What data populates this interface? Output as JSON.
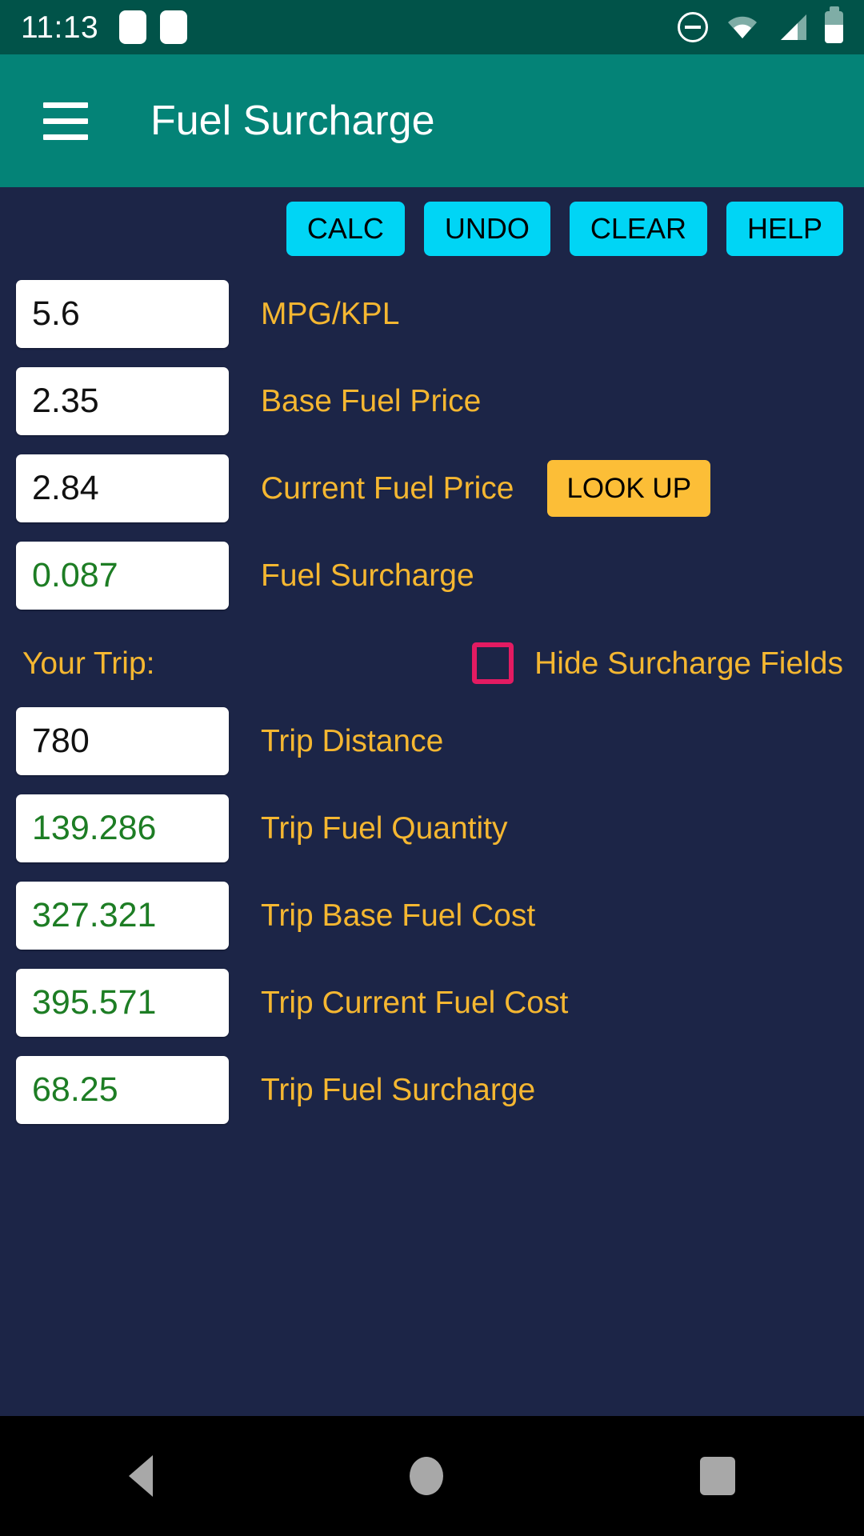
{
  "status_bar": {
    "clock": "11:13",
    "icons": [
      "notification-block-icon",
      "notification-block-icon",
      "do-not-disturb-icon",
      "wifi-icon",
      "cellular-signal-icon",
      "battery-icon"
    ]
  },
  "app_bar": {
    "menu_icon": "hamburger-menu-icon",
    "title": "Fuel Surcharge"
  },
  "toolbar": {
    "calc_label": "CALC",
    "undo_label": "UNDO",
    "clear_label": "CLEAR",
    "help_label": "HELP"
  },
  "surcharge_fields": [
    {
      "value": "5.6",
      "label": "MPG/KPL",
      "computed": false,
      "name": "mpg-kpl"
    },
    {
      "value": "2.35",
      "label": "Base Fuel Price",
      "computed": false,
      "name": "base-fuel-price"
    },
    {
      "value": "2.84",
      "label": "Current Fuel Price",
      "computed": false,
      "name": "current-fuel-price"
    },
    {
      "value": "0.087",
      "label": "Fuel Surcharge",
      "computed": true,
      "name": "fuel-surcharge"
    }
  ],
  "lookup": {
    "label": "LOOK UP"
  },
  "trip_section": {
    "title": "Your Trip:",
    "checkbox_label": "Hide Surcharge Fields",
    "checkbox_checked": false
  },
  "trip_fields": [
    {
      "value": "780",
      "label": "Trip Distance",
      "computed": false,
      "name": "trip-distance"
    },
    {
      "value": "139.286",
      "label": "Trip Fuel Quantity",
      "computed": true,
      "name": "trip-fuel-quantity"
    },
    {
      "value": "327.321",
      "label": "Trip Base Fuel Cost",
      "computed": true,
      "name": "trip-base-fuel-cost"
    },
    {
      "value": "395.571",
      "label": "Trip Current Fuel Cost",
      "computed": true,
      "name": "trip-current-fuel-cost"
    },
    {
      "value": "68.25",
      "label": "Trip Fuel Surcharge",
      "computed": true,
      "name": "trip-fuel-surcharge"
    }
  ],
  "nav_bar": {
    "back": "back-nav-icon",
    "home": "home-nav-icon",
    "recents": "recents-nav-icon"
  },
  "colors": {
    "status_bar": "#015349",
    "app_bar": "#048377",
    "background": "#1c2547",
    "top_button": "#00d5f5",
    "lookup_button": "#fcbe37",
    "label_text": "#f5b731",
    "computed_value": "#1d7d24",
    "checkbox_border": "#e31b62",
    "nav_bar": "#000000"
  }
}
